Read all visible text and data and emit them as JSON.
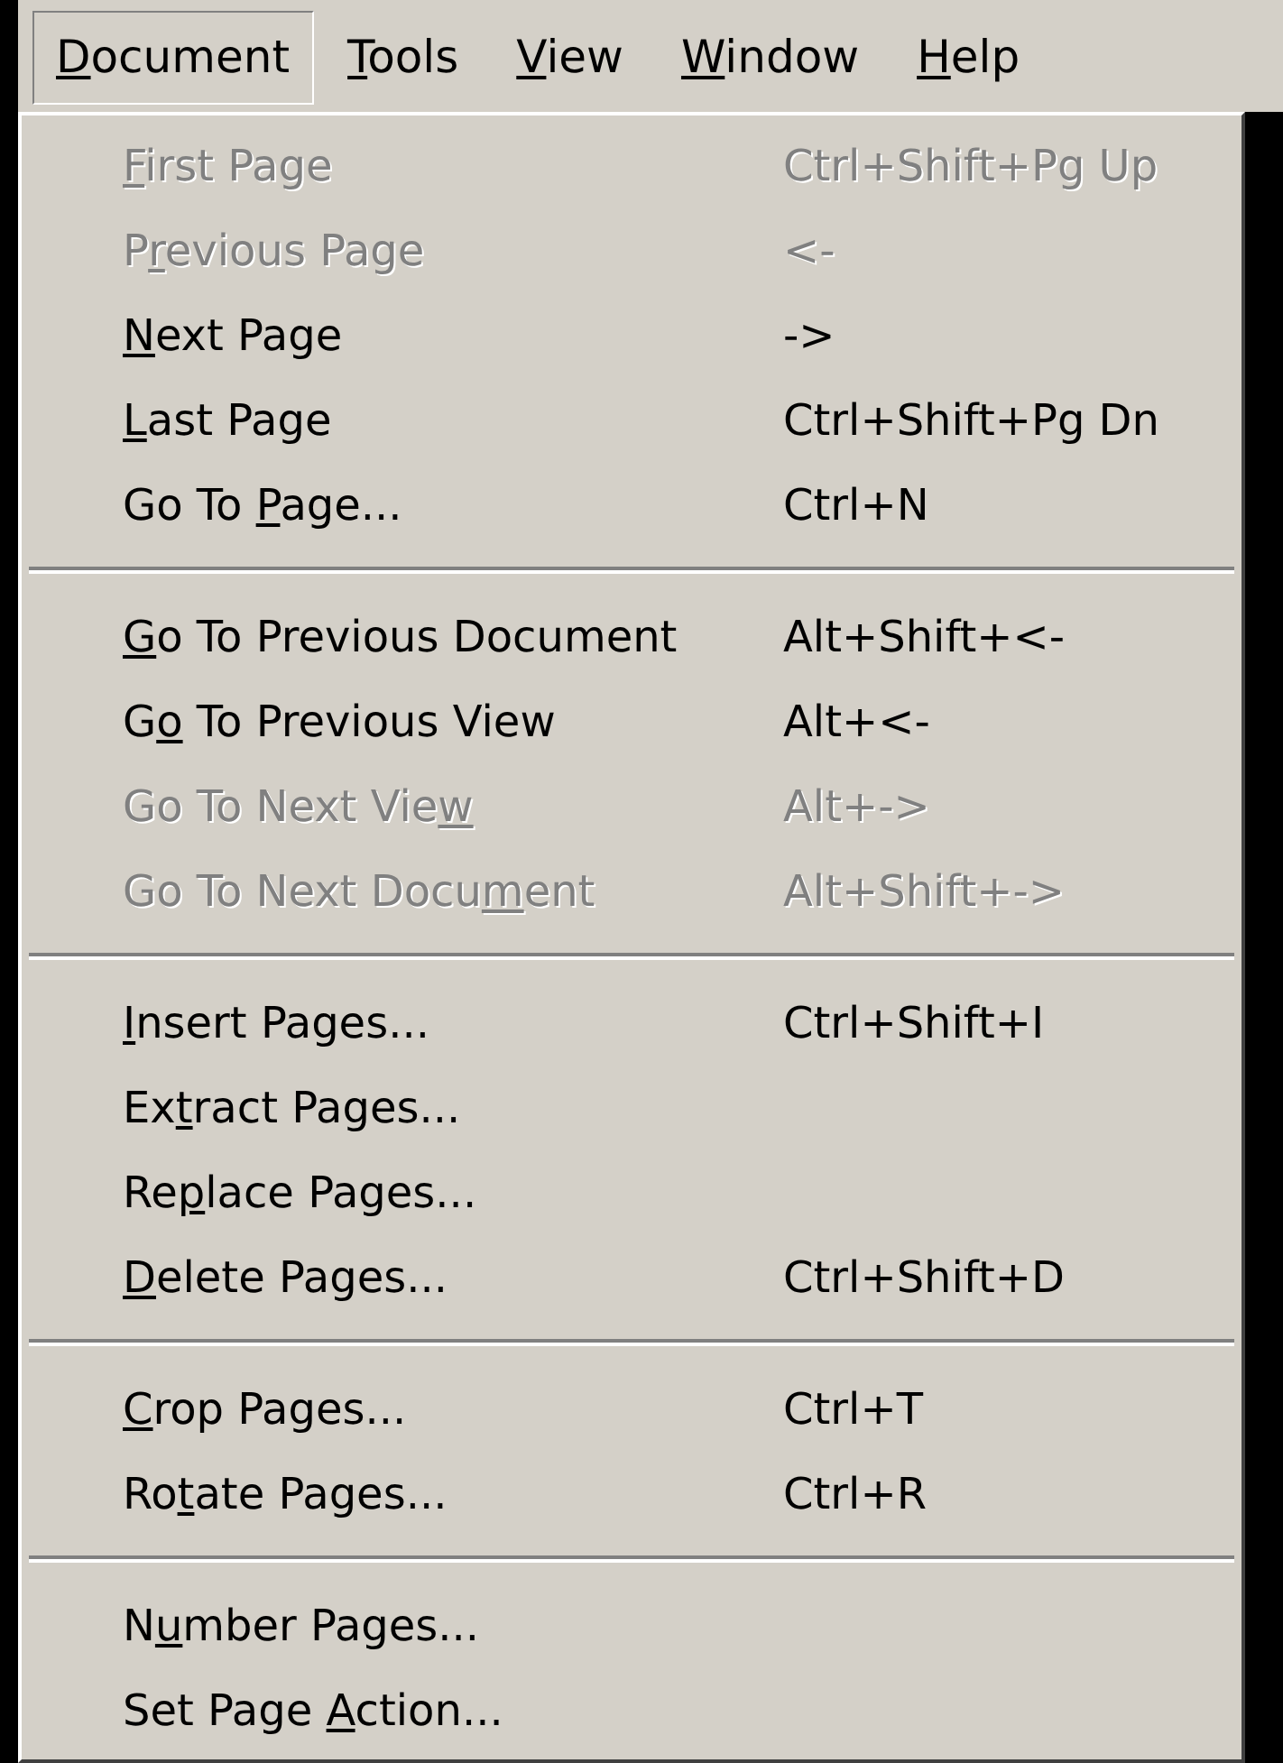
{
  "menu_bar": [
    {
      "key": "D",
      "post": "ocument",
      "selected": true
    },
    {
      "key": "T",
      "post": "ools",
      "selected": false
    },
    {
      "key": "V",
      "post": "iew",
      "selected": false
    },
    {
      "key": "W",
      "post": "indow",
      "selected": false
    },
    {
      "key": "H",
      "post": "elp",
      "selected": false
    }
  ],
  "menu": {
    "sections": [
      {
        "items": [
          {
            "key": "F",
            "post": "irst Page",
            "shortcut": "Ctrl+Shift+Pg Up",
            "disabled": true
          },
          {
            "pre": "P",
            "key": "r",
            "post": "evious Page",
            "shortcut": "<-",
            "disabled": true
          },
          {
            "key": "N",
            "post": "ext Page",
            "shortcut": "->",
            "disabled": false
          },
          {
            "key": "L",
            "post": "ast Page",
            "shortcut": "Ctrl+Shift+Pg Dn",
            "disabled": false
          },
          {
            "pre": "Go To ",
            "key": "P",
            "post": "age...",
            "shortcut": "Ctrl+N",
            "disabled": false
          }
        ]
      },
      {
        "items": [
          {
            "key": "G",
            "post": "o To Previous Document",
            "shortcut": "Alt+Shift+<-",
            "disabled": false
          },
          {
            "pre": "G",
            "key": "o",
            "post": " To Previous View",
            "shortcut": "Alt+<-",
            "disabled": false
          },
          {
            "pre": "Go To Next Vie",
            "key": "w",
            "shortcut": "Alt+->",
            "disabled": true
          },
          {
            "pre": "Go To Next Docu",
            "key": "m",
            "post": "ent",
            "shortcut": "Alt+Shift+->",
            "disabled": true
          }
        ]
      },
      {
        "items": [
          {
            "key": "I",
            "post": "nsert Pages...",
            "shortcut": "Ctrl+Shift+I",
            "disabled": false
          },
          {
            "pre": "Ex",
            "key": "t",
            "post": "ract Pages...",
            "disabled": false
          },
          {
            "pre": "Re",
            "key": "p",
            "post": "lace Pages...",
            "disabled": false
          },
          {
            "key": "D",
            "post": "elete Pages...",
            "shortcut": "Ctrl+Shift+D",
            "disabled": false
          }
        ]
      },
      {
        "items": [
          {
            "key": "C",
            "post": "rop Pages...",
            "shortcut": "Ctrl+T",
            "disabled": false
          },
          {
            "pre": "Ro",
            "key": "t",
            "post": "ate Pages...",
            "shortcut": "Ctrl+R",
            "disabled": false
          }
        ]
      },
      {
        "items": [
          {
            "pre": "N",
            "key": "u",
            "post": "mber Pages...",
            "disabled": false
          },
          {
            "pre": "Set Page ",
            "key": "A",
            "post": "ction...",
            "disabled": false
          }
        ]
      }
    ]
  }
}
